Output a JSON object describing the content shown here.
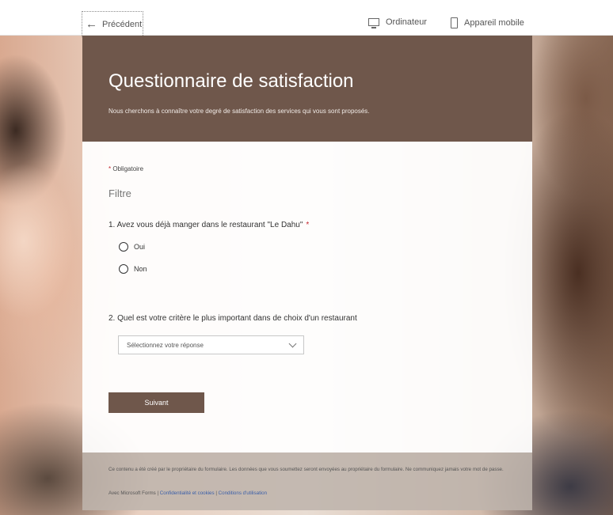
{
  "topbar": {
    "back_label": "Précédent",
    "view_desktop_label": "Ordinateur",
    "view_mobile_label": "Appareil mobile"
  },
  "form": {
    "title": "Questionnaire de satisfaction",
    "subtitle": "Nous cherchons à connaître votre degré de satisfaction des services qui vous sont proposés.",
    "required_star": "*",
    "required_note": "Obligatoire",
    "section_title": "Filtre",
    "question1": {
      "label": "1. Avez vous déjà manger dans le restaurant \"Le Dahu\"",
      "star": "*",
      "options": [
        "Oui",
        "Non"
      ]
    },
    "question2": {
      "label": "2. Quel est votre critère le plus important dans de choix d'un restaurant",
      "placeholder": "Sélectionnez votre réponse"
    },
    "next_label": "Suivant"
  },
  "footer": {
    "note": "Ce contenu a été créé par le propriétaire du formulaire. Les données que vous soumettez seront envoyées au propriétaire du formulaire. Ne communiquez jamais votre mot de passe.",
    "powered_by": "Avec Microsoft Forms",
    "separator": "|",
    "privacy_link": "Confidentialité et cookies",
    "terms_link": "Conditions d'utilisation"
  },
  "colors": {
    "brand": "#6f574b",
    "required": "#c4262e",
    "link": "#3b5fa8"
  }
}
